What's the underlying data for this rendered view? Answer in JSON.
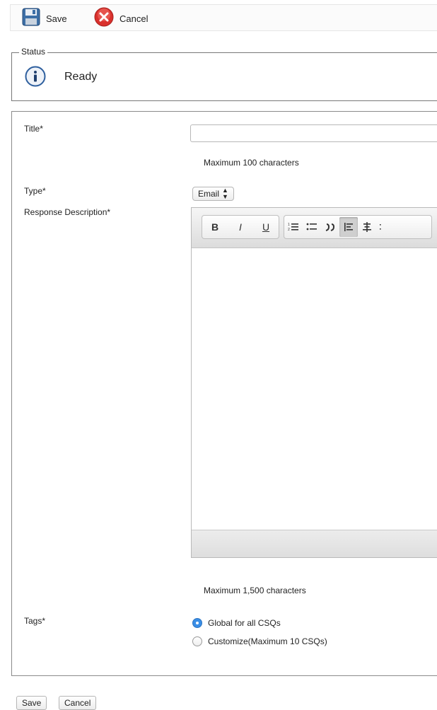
{
  "toolbar": {
    "save_label": "Save",
    "cancel_label": "Cancel"
  },
  "status": {
    "legend": "Status",
    "text": "Ready",
    "icon": "info-icon"
  },
  "form": {
    "title_label": "Title*",
    "title_value": "",
    "title_hint": "Maximum 100 characters",
    "type_label": "Type*",
    "type_selected": "Email",
    "description_label": "Response Description*",
    "description_hint": "Maximum 1,500 characters",
    "tags_label": "Tags*",
    "tags_options": [
      {
        "label": "Global for all CSQs",
        "selected": true
      },
      {
        "label": "Customize(Maximum 10 CSQs)",
        "selected": false
      }
    ]
  },
  "editor_toolbar": {
    "bold": "B",
    "italic": "I",
    "underline": "U",
    "ordered_list": "1≡",
    "unordered_list": "∷",
    "quote": "99",
    "align_left": "align-left-icon",
    "align_center": "align-center-icon"
  },
  "bottom": {
    "save_label": "Save",
    "cancel_label": "Cancel"
  },
  "colors": {
    "radio_selected": "#3a8ee6",
    "cancel_icon": "#d9302c",
    "info_icon": "#2e5f9e"
  }
}
